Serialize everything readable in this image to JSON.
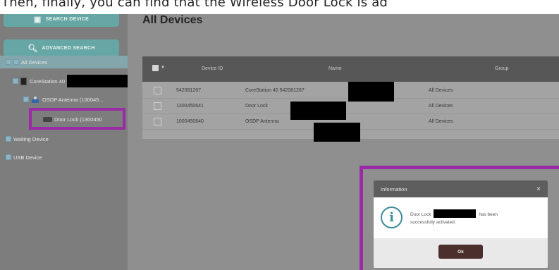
{
  "caption": {
    "text": "Then, finally, you can find that the Wireless Door Lock is ad"
  },
  "sidebar": {
    "search_device_label": "SEARCH DEVICE",
    "advanced_search_label": "ADVANCED SEARCH",
    "tree": {
      "all_devices": "All Devices",
      "corestation": "CoreStation 40",
      "osdp_antenna": "OSDP Antenna (100045...",
      "door_lock": "Door Lock (1300450",
      "waiting_device": "Waiting Device",
      "usb_device": "USB Device"
    }
  },
  "main": {
    "title": "All Devices",
    "table": {
      "columns": [
        "Device ID",
        "Name",
        "Group"
      ],
      "rows": [
        {
          "device_id": "542081267",
          "name": "CoreStation 40 542081267",
          "group": "All Devices"
        },
        {
          "device_id": "1300450641",
          "name": "Door Lock",
          "group": "All Devices"
        },
        {
          "device_id": "1000450640",
          "name": "OSDP Antenna",
          "group": "All Devices"
        }
      ]
    }
  },
  "dialog": {
    "title": "Information",
    "close_glyph": "×",
    "info_glyph": "i",
    "message_prefix": "Door Lock",
    "message_suffix": "has been",
    "message_line2": "successfully activated.",
    "ok_label": "Ok"
  },
  "colors": {
    "accent_teal": "#66a7a5",
    "highlight_purple": "#9a2aa6",
    "redaction": "#000000"
  }
}
